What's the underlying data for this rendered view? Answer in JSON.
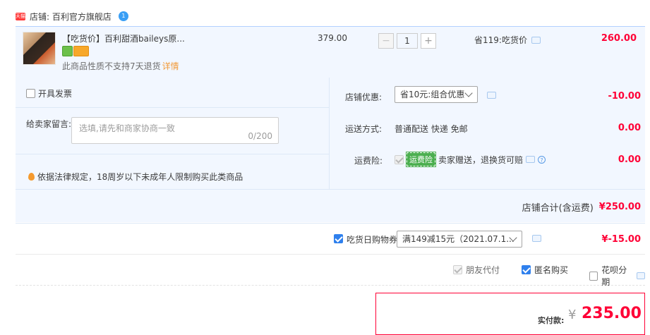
{
  "shop": {
    "label": "店铺: 百利官方旗舰店",
    "icon_text": "天猫",
    "chat_badge": "1"
  },
  "item": {
    "title": "【吃货价】百利甜酒baileys原...",
    "unit_price": "379.00",
    "quantity": "1",
    "minus_label": "−",
    "plus_label": "+",
    "discount_text": "省119:吃货价",
    "total": "260.00",
    "note": "此商品性质不支持7天退货",
    "note_link": "详情"
  },
  "options": {
    "invoice_label": "开具发票",
    "message_label": "给卖家留言:",
    "message_placeholder": "选填,请先和商家协商一致",
    "message_counter": "0/200",
    "law_notice": "依据法律规定，18周岁以下未成年人限制购买此类商品",
    "shop_discount_label": "店铺优惠:",
    "shop_discount_selected": "省10元:组合优惠",
    "shop_discount_value": "-10.00",
    "shipping_label": "运送方式:",
    "shipping_text": "普通配送 快递 免邮",
    "shipping_value": "0.00",
    "insurance_label": "运费险:",
    "insurance_badge": "运费险",
    "insurance_text": "卖家赠送，退换货可赔",
    "insurance_value": "0.00",
    "shop_total_label": "店铺合计(含运费)",
    "shop_total_value": "¥250.00"
  },
  "coupon": {
    "label": "吃货日购物券",
    "selected": "满149减15元（2021.07.1...",
    "value": "¥-15.00"
  },
  "pay_options": {
    "friend_pay": "朋友代付",
    "anonymous": "匿名购买",
    "huabei": "花呗分期"
  },
  "payment": {
    "label": "实付款:",
    "currency": "¥",
    "amount": "235.00"
  },
  "colors": {
    "price_red": "#ff0036",
    "accent_blue": "#2f80ed",
    "panel_bg": "#f2f7ff"
  }
}
